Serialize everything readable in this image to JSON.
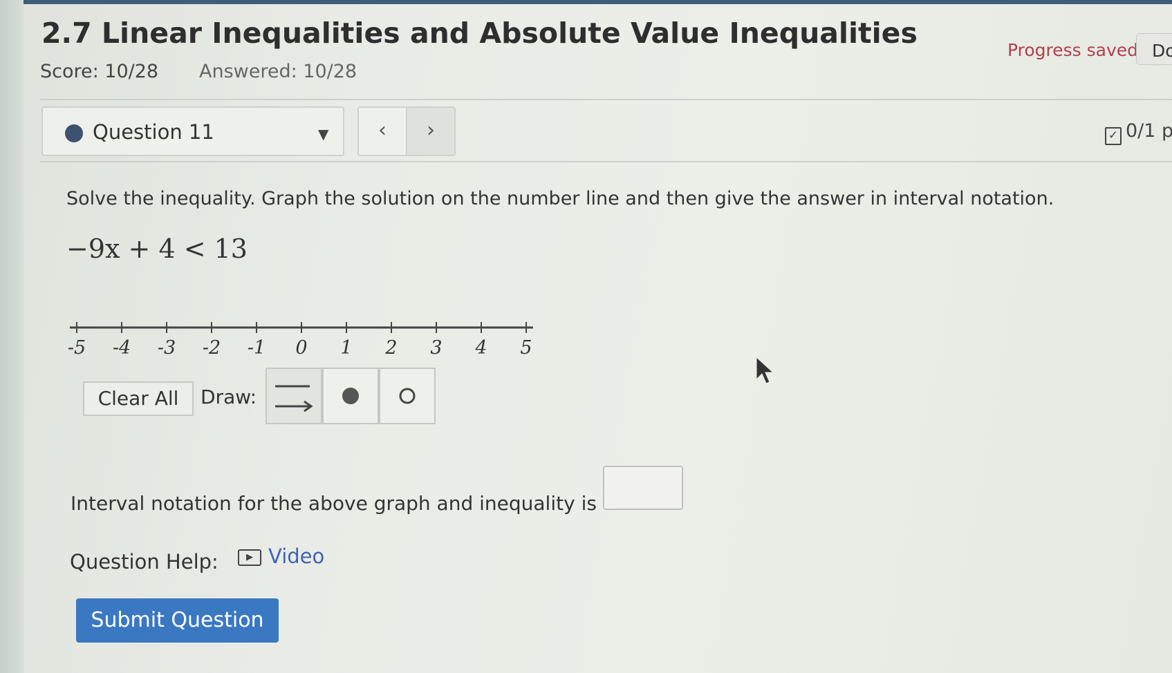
{
  "header": {
    "title": "2.7 Linear Inequalities and Absolute Value Inequalities",
    "score": "Score: 10/28",
    "answered": "Answered: 10/28",
    "progress_status": "Progress saved",
    "done_label": "Do"
  },
  "question_nav": {
    "selected": "Question 11",
    "prev_symbol": "‹",
    "next_symbol": "›",
    "points": "0/1 p"
  },
  "question": {
    "instructions": "Solve the inequality. Graph the solution on the number line and then give the answer in interval notation.",
    "inequality": "−9x + 4 < 13",
    "number_line": {
      "ticks": [
        "-5",
        "-4",
        "-3",
        "-2",
        "-1",
        "0",
        "1",
        "2",
        "3",
        "4",
        "5"
      ]
    },
    "tools": {
      "clear_all_label": "Clear All",
      "draw_label": "Draw:",
      "items": [
        "ray",
        "closed-dot",
        "open-dot"
      ]
    },
    "interval_label": "Interval notation for the above graph and inequality is",
    "interval_value": ""
  },
  "help": {
    "label": "Question Help:",
    "video_label": "Video"
  },
  "submit_label": "Submit Question",
  "colors": {
    "accent": "#3a78c2",
    "status": "#b3404a",
    "dot": "#3e5170",
    "link": "#3f63b8"
  }
}
